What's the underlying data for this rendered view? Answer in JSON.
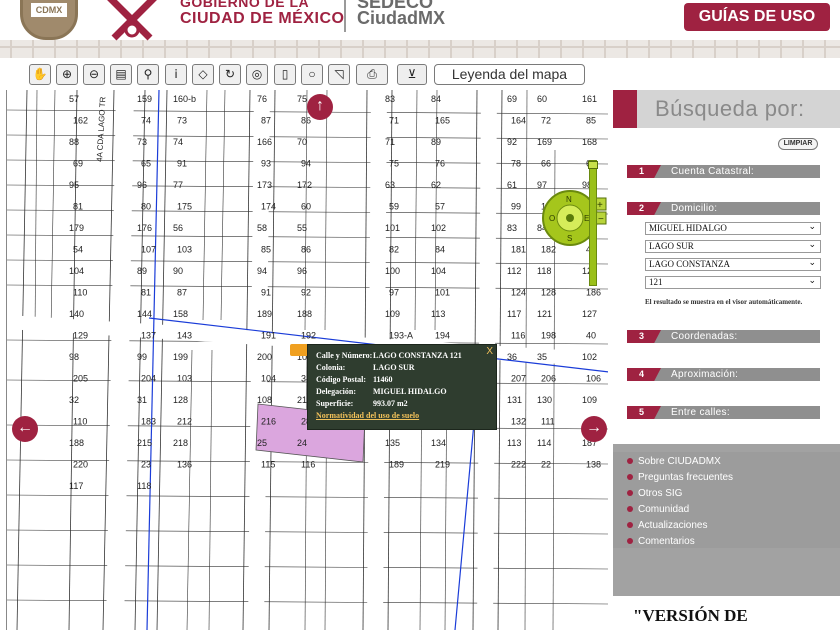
{
  "header": {
    "gov_line1": "GOBIERNO DE LA",
    "gov_line2": "CIUDAD DE MÉXICO",
    "sedeco": "SEDECO",
    "ciudadmx": "CiudadMX",
    "guides_button": "GUÍAS DE USO",
    "shield_text": "CDMX"
  },
  "toolbar": {
    "tools": [
      "pan-icon",
      "zoom-in-icon",
      "zoom-out-icon",
      "extent-icon",
      "walk-icon",
      "info-icon",
      "eraser-icon",
      "refresh-icon",
      "target-icon",
      "bookmark-icon",
      "lasso-icon",
      "select-area-icon",
      "print-icon",
      "download-icon"
    ],
    "legend_label": "Leyenda del mapa"
  },
  "map": {
    "streets": [
      "4A CDA LAGO TR"
    ],
    "lot_numbers": [
      "57",
      "159",
      "160-b",
      "76",
      "75",
      "83",
      "84",
      "69",
      "60",
      "161",
      "162",
      "74",
      "73",
      "87",
      "86",
      "71",
      "165",
      "164",
      "72",
      "85",
      "88",
      "73",
      "74",
      "166",
      "70",
      "71",
      "89",
      "92",
      "169",
      "168",
      "69",
      "65",
      "91",
      "93",
      "94",
      "75",
      "76",
      "78",
      "66",
      "64",
      "95",
      "96",
      "77",
      "173",
      "172",
      "63",
      "62",
      "61",
      "97",
      "98",
      "81",
      "80",
      "175",
      "174",
      "60",
      "59",
      "57",
      "99",
      "100bis",
      "82",
      "179",
      "176",
      "56",
      "58",
      "55",
      "101",
      "102",
      "83",
      "84",
      "178",
      "54",
      "107",
      "103",
      "85",
      "86",
      "82",
      "84",
      "181",
      "182",
      "47",
      "104",
      "89",
      "90",
      "94",
      "96",
      "100",
      "104",
      "112",
      "118",
      "120",
      "110",
      "81",
      "87",
      "91",
      "92",
      "97",
      "101",
      "124",
      "128",
      "186",
      "140",
      "144",
      "158",
      "189",
      "188",
      "109",
      "113",
      "117",
      "121",
      "127",
      "129",
      "137",
      "143",
      "191",
      "192",
      "193-A",
      "194",
      "116",
      "198",
      "40",
      "98",
      "99",
      "199",
      "200",
      "100",
      "38",
      "37",
      "36",
      "35",
      "102",
      "205",
      "204",
      "103",
      "104",
      "34",
      "33",
      "105",
      "207",
      "206",
      "106",
      "32",
      "31",
      "128",
      "108",
      "210",
      "30",
      "29",
      "131",
      "130",
      "109",
      "110",
      "183",
      "212",
      "216",
      "28",
      "27",
      "133",
      "132",
      "111",
      "112",
      "188",
      "215",
      "218",
      "25",
      "24",
      "135",
      "134",
      "113",
      "114",
      "187",
      "220",
      "23",
      "136",
      "115",
      "116",
      "189",
      "219",
      "222",
      "22",
      "138",
      "117",
      "118"
    ],
    "popup": {
      "rows": [
        {
          "label": "Calle y Número:",
          "value": "LAGO CONSTANZA 121"
        },
        {
          "label": "Colonia:",
          "value": "LAGO SUR"
        },
        {
          "label": "Código Postal:",
          "value": "11460"
        },
        {
          "label": "Delegación:",
          "value": "MIGUEL HIDALGO"
        },
        {
          "label": "Superficie:",
          "value": "993.07 m2"
        }
      ],
      "link": "Normatividad del uso de suelo",
      "close": "X"
    },
    "compass": {
      "n": "N",
      "s": "S",
      "e": "E",
      "o": "O"
    }
  },
  "panel": {
    "title": "Búsqueda por:",
    "clear_button": "LIMPIAR",
    "sections": [
      {
        "num": "1",
        "label": "Cuenta Catastral:"
      },
      {
        "num": "2",
        "label": "Domicilio:"
      },
      {
        "num": "3",
        "label": "Coordenadas:"
      },
      {
        "num": "4",
        "label": "Aproximación:"
      },
      {
        "num": "5",
        "label": "Entre calles:"
      }
    ],
    "selects": [
      "MIGUEL HIDALGO",
      "LAGO SUR",
      "LAGO CONSTANZA",
      "121"
    ],
    "hint": "El resultado se muestra en el visor automáticamente.",
    "links": [
      "Sobre CIUDADMX",
      "Preguntas frecuentes",
      "Otros SIG",
      "Comunidad",
      "Actualizaciones",
      "Comentarios"
    ],
    "version": "\"VERSIÓN DE"
  },
  "colors": {
    "accent": "#9f2241",
    "parcel": "#dba6de",
    "popup_bg": "#2f3d2f",
    "road_blue": "#1a3cd8"
  }
}
